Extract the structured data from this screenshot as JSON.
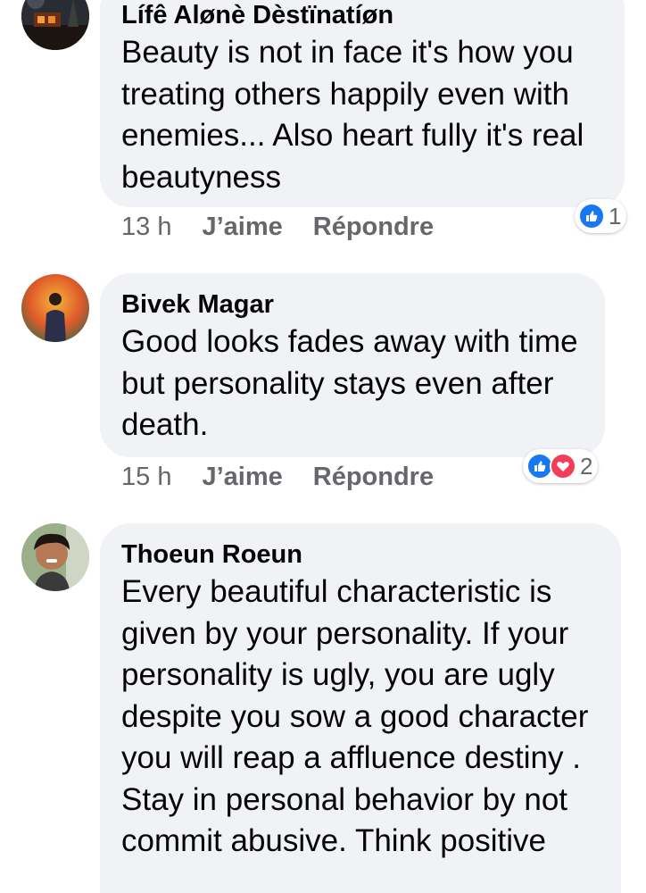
{
  "comments": [
    {
      "author": "Lífê Alønè Dèstïnatíøn",
      "text": "Beauty is not in face it's how you treating others happily even with enemies... Also heart fully it's real beautyness",
      "time": "13 h",
      "like_label": "J’aime",
      "reply_label": "Répondre",
      "reaction_count": "1",
      "reactions": [
        "like-icon"
      ]
    },
    {
      "author": "Bivek Magar",
      "text": "Good looks fades away with time but personality stays even after death.",
      "time": "15 h",
      "like_label": "J’aime",
      "reply_label": "Répondre",
      "reaction_count": "2",
      "reactions": [
        "like-icon",
        "love-icon"
      ]
    },
    {
      "author": "Thoeun Roeun",
      "text": "Every beautiful characteristic is given by your personality. If your personality is ugly, you are ugly despite you sow a good character you will reap a affluence destiny . Stay in personal behavior by not commit abusive. Think positive",
      "time": "",
      "like_label": "",
      "reply_label": "",
      "reaction_count": "",
      "reactions": []
    }
  ],
  "colors": {
    "bubble": "#f0f2f5",
    "like": "#1877f2",
    "love": "#f33e58",
    "meta_text": "#65676b"
  }
}
